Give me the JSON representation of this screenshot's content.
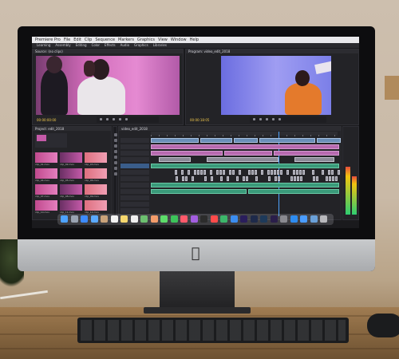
{
  "app": {
    "menubar": [
      "Premiere Pro",
      "File",
      "Edit",
      "Clip",
      "Sequence",
      "Markers",
      "Graphics",
      "View",
      "Window",
      "Help"
    ],
    "workspaces": [
      "Learning",
      "Assembly",
      "Editing",
      "Color",
      "Effects",
      "Audio",
      "Graphics",
      "Libraries"
    ]
  },
  "source_monitor": {
    "tab_label": "Source: (no clips)",
    "timecode": "00:00:00:00"
  },
  "program_monitor": {
    "tab_label": "Program: video_edit_2018",
    "timecode": "00:00:18:05"
  },
  "project_panel": {
    "tab_label": "Project: edit_2018",
    "thumbnail_labels": [
      "clip_01.mov",
      "clip_02.mov",
      "clip_03.mov",
      "clip_04.mov",
      "clip_05.mov",
      "clip_06.mov",
      "clip_07.mov",
      "clip_08.mov",
      "clip_09.mov",
      "clip_10.mov",
      "clip_11.mov",
      "clip_12.mov"
    ]
  },
  "timeline": {
    "tab_label": "video_edit_2018"
  },
  "dock": {
    "icons": [
      "finder-icon",
      "launchpad-icon",
      "safari-icon",
      "mail-icon",
      "contacts-icon",
      "calendar-icon",
      "notes-icon",
      "reminders-icon",
      "maps-icon",
      "photos-icon",
      "messages-icon",
      "facetime-icon",
      "music-icon",
      "podcasts-icon",
      "tv-icon",
      "news-icon",
      "numbers-icon",
      "keynote-icon",
      "premiere-icon",
      "lightroom-icon",
      "photoshop-icon",
      "after-effects-icon",
      "system-preferences-icon",
      "app-store-icon",
      "finder-window-icon",
      "downloads-icon",
      "trash-icon"
    ],
    "colors": [
      "#4ea3ff",
      "#9aa4b2",
      "#3d8bff",
      "#5aa9ff",
      "#c9a27a",
      "#f2f2f2",
      "#f5d76e",
      "#f0f0f0",
      "#6cc070",
      "#f39c6b",
      "#5ddc6a",
      "#3cc35a",
      "#ff5a6b",
      "#a35ee0",
      "#2c2c2c",
      "#ff4b4b",
      "#3cb66a",
      "#3b8df0",
      "#2a1e5c",
      "#1e2a4a",
      "#1e3a5a",
      "#2a1e4a",
      "#8a8a90",
      "#2e8cf0",
      "#4a9cff",
      "#6aa0d8",
      "#b8b8bc"
    ]
  }
}
